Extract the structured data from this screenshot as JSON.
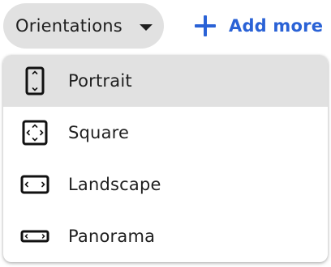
{
  "toolbar": {
    "orientations_label": "Orientations",
    "add_more_label": "Add more",
    "accent_color": "#2a62d6"
  },
  "menu": {
    "items": [
      {
        "label": "Portrait",
        "icon": "portrait-icon",
        "selected": true
      },
      {
        "label": "Square",
        "icon": "square-icon",
        "selected": false
      },
      {
        "label": "Landscape",
        "icon": "landscape-icon",
        "selected": false
      },
      {
        "label": "Panorama",
        "icon": "panorama-icon",
        "selected": false
      }
    ]
  }
}
